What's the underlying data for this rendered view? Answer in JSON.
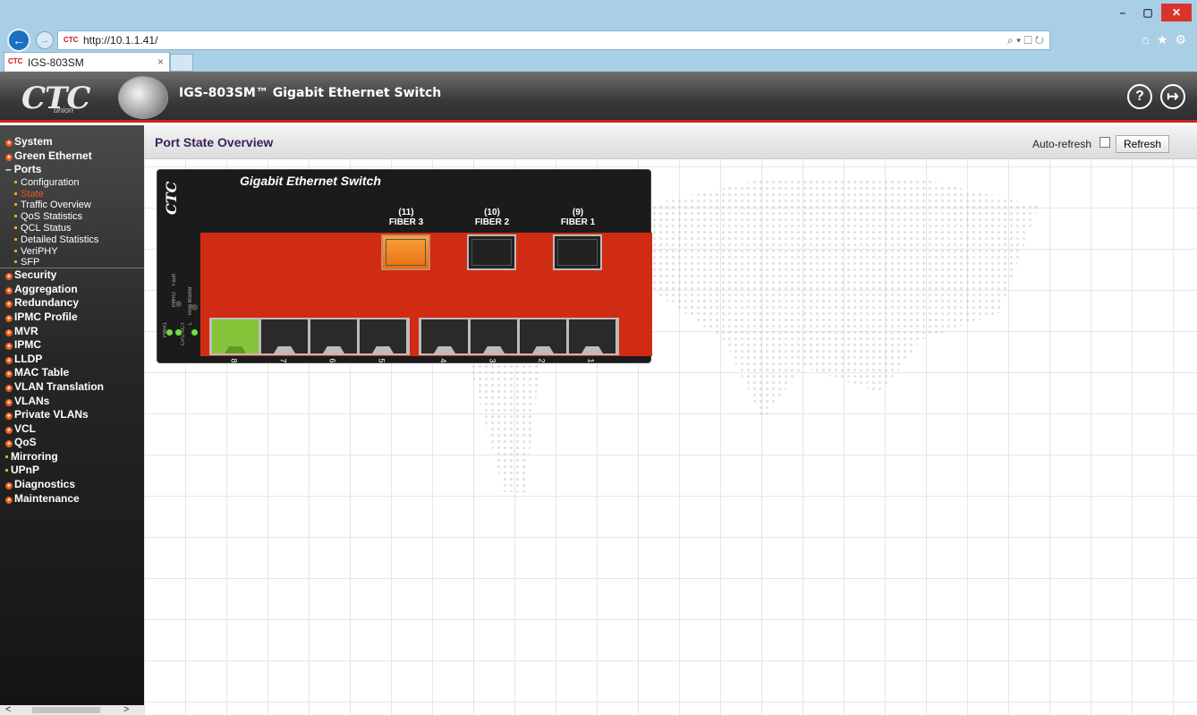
{
  "browser": {
    "url": "http://10.1.1.41/",
    "tab_title": "IGS-803SM",
    "tab_close": "×",
    "url_tools": "⌕ ▾ ☐ ↻",
    "window_buttons": [
      "–",
      "▢",
      "✕"
    ],
    "toolbar_icons": [
      "⌂",
      "★",
      "⚙"
    ]
  },
  "header": {
    "logo_text": "CTC",
    "logo_sub": "union",
    "app_title": "IGS-803SM™ Gigabit Ethernet Switch",
    "help_label": "?",
    "logout_label": "↦"
  },
  "sidebar": {
    "items": [
      {
        "label": "System",
        "type": "top"
      },
      {
        "label": "Green Ethernet",
        "type": "top"
      },
      {
        "label": "Ports",
        "type": "open"
      },
      {
        "label": "Configuration",
        "type": "sub"
      },
      {
        "label": "State",
        "type": "sub",
        "active": true
      },
      {
        "label": "Traffic Overview",
        "type": "sub"
      },
      {
        "label": "QoS Statistics",
        "type": "sub"
      },
      {
        "label": "QCL Status",
        "type": "sub"
      },
      {
        "label": "Detailed Statistics",
        "type": "sub"
      },
      {
        "label": "VeriPHY",
        "type": "sub"
      },
      {
        "label": "SFP",
        "type": "sub"
      },
      {
        "label": "Security",
        "type": "top"
      },
      {
        "label": "Aggregation",
        "type": "top"
      },
      {
        "label": "Redundancy",
        "type": "top"
      },
      {
        "label": "IPMC Profile",
        "type": "top"
      },
      {
        "label": "MVR",
        "type": "top"
      },
      {
        "label": "IPMC",
        "type": "top"
      },
      {
        "label": "LLDP",
        "type": "top"
      },
      {
        "label": "MAC Table",
        "type": "top"
      },
      {
        "label": "VLAN Translation",
        "type": "top"
      },
      {
        "label": "VLANs",
        "type": "top"
      },
      {
        "label": "Private VLANs",
        "type": "top"
      },
      {
        "label": "VCL",
        "type": "top"
      },
      {
        "label": "QoS",
        "type": "top"
      },
      {
        "label": "Mirroring",
        "type": "plain"
      },
      {
        "label": "UPnP",
        "type": "plain"
      },
      {
        "label": "Diagnostics",
        "type": "top"
      },
      {
        "label": "Maintenance",
        "type": "top"
      }
    ],
    "scroll_left": "<",
    "scroll_right": ">"
  },
  "main": {
    "page_title": "Port State Overview",
    "auto_refresh_label": "Auto-refresh",
    "auto_refresh_checked": false,
    "refresh_button": "Refresh"
  },
  "switch_panel": {
    "title": "Gigabit Ethernet Switch",
    "logo": "CTC",
    "fiber_ports": [
      {
        "num": "(11)",
        "name": "FIBER 3",
        "active": true
      },
      {
        "num": "(10)",
        "name": "FIBER 2",
        "active": false
      },
      {
        "num": "(9)",
        "name": "FIBER 1",
        "active": false
      }
    ],
    "rj45_ports": [
      {
        "num": "8",
        "active": true
      },
      {
        "num": "7",
        "active": false
      },
      {
        "num": "6",
        "active": false
      },
      {
        "num": "5",
        "active": false
      },
      {
        "num": "4",
        "active": false
      },
      {
        "num": "3",
        "active": false
      },
      {
        "num": "2",
        "active": false
      },
      {
        "num": "1",
        "active": false
      }
    ],
    "led_labels": [
      "PWR1",
      "PWR2",
      "Fault",
      "CPU ACT",
      "Ring Master",
      "L"
    ],
    "colors": {
      "panel_red": "#d02c14",
      "link_green": "#86c43a",
      "fiber_active": "#f08a22"
    }
  }
}
